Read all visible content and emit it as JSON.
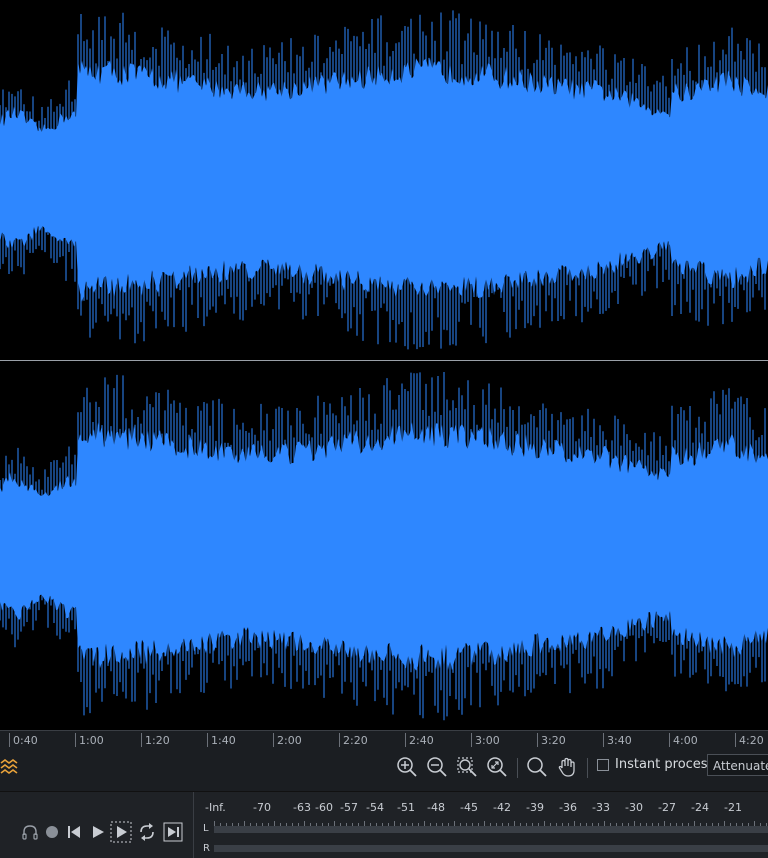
{
  "timeline": {
    "ticks": [
      {
        "label": "0:40"
      },
      {
        "label": "1:00"
      },
      {
        "label": "1:20"
      },
      {
        "label": "1:40"
      },
      {
        "label": "2:00"
      },
      {
        "label": "2:20"
      },
      {
        "label": "2:40"
      },
      {
        "label": "3:00"
      },
      {
        "label": "3:20"
      },
      {
        "label": "3:40"
      },
      {
        "label": "4:00"
      },
      {
        "label": "4:20"
      }
    ]
  },
  "toolbar": {
    "instant_process_label": "Instant process",
    "mode_value": "Attenuate"
  },
  "meter": {
    "scale": [
      "-Inf.",
      "-70",
      "-63",
      "-60",
      "-57",
      "-54",
      "-51",
      "-48",
      "-45",
      "-42",
      "-39",
      "-36",
      "-33",
      "-30",
      "-27",
      "-24",
      "-21"
    ],
    "channels": {
      "left": "L",
      "right": "R"
    }
  },
  "colors": {
    "waveform": "#2e87ff",
    "accent": "#e8a23a",
    "background": "#000000"
  }
}
